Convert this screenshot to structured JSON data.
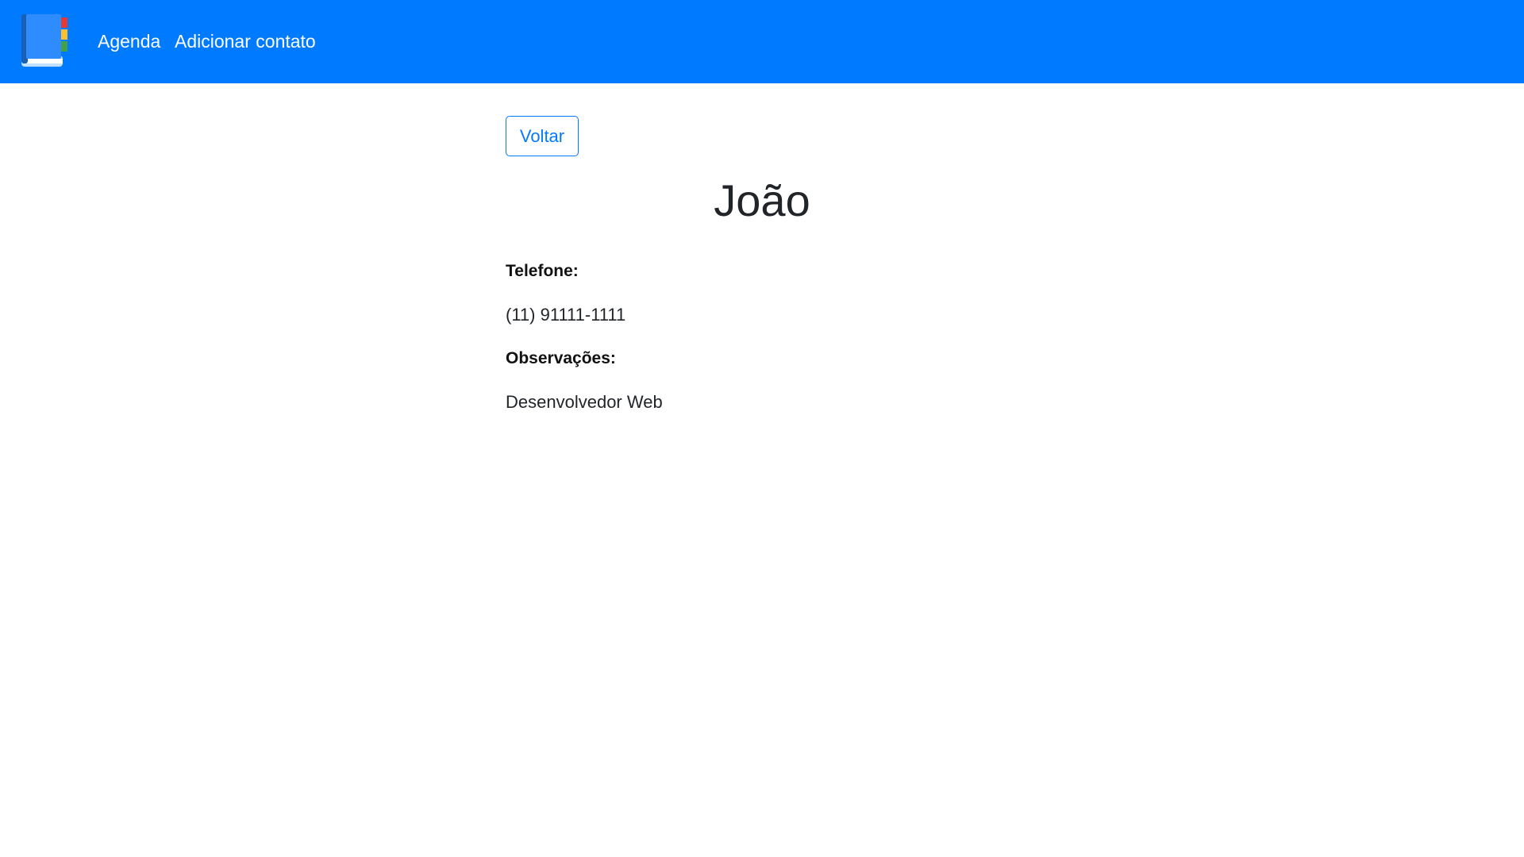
{
  "navbar": {
    "logo_icon": "address-book-icon",
    "links": [
      {
        "label": "Agenda"
      },
      {
        "label": "Adicionar contato"
      }
    ],
    "background_color": "#007bff"
  },
  "main": {
    "back_button_label": "Voltar",
    "contact_name": "João",
    "fields": {
      "phone_label": "Telefone:",
      "phone_value": "(11) 91111-1111",
      "notes_label": "Observações:",
      "notes_value": "Desenvolvedor Web"
    },
    "accent_color": "#007bff"
  }
}
